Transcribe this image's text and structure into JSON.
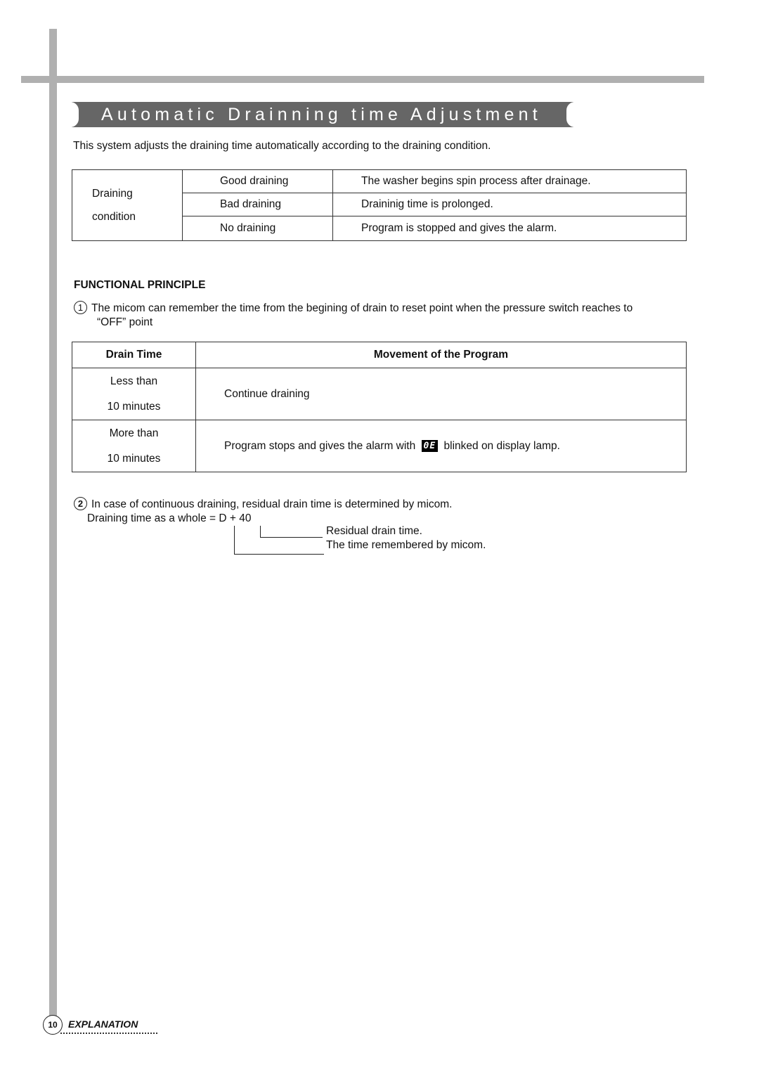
{
  "title": "Automatic Drainning time Adjustment",
  "intro": "This system adjusts the draining time automatically according to the draining condition.",
  "condition_table": {
    "row_header_line1": "Draining",
    "row_header_line2": "condition",
    "rows": [
      {
        "state": "Good draining",
        "result": "The washer begins spin process after drainage."
      },
      {
        "state": "Bad draining",
        "result": "Draininig time is prolonged."
      },
      {
        "state": "No draining",
        "result": "Program is stopped and gives the alarm."
      }
    ]
  },
  "section_heading": "FUNCTIONAL PRINCIPLE",
  "point1": {
    "number": "1",
    "line1": "The micom can remember the time from the begining of drain to reset point when the pressure switch reaches to",
    "line2": "“OFF” point"
  },
  "drain_table": {
    "headers": [
      "Drain Time",
      "Movement of the Program"
    ],
    "rows": [
      {
        "time_line1": "Less than",
        "time_line2": "10 minutes",
        "movement": "Continue draining"
      },
      {
        "time_line1": "More than",
        "time_line2": "10 minutes",
        "movement_before": "Program stops and gives the alarm with",
        "display_code": "0E",
        "movement_after": "blinked on display lamp."
      }
    ]
  },
  "point2": {
    "number": "2",
    "line1": "In case of continuous draining, residual drain time is determined by micom.",
    "line2": "Draining time as a whole = D + 40",
    "label_residual": "Residual drain time.",
    "label_remembered": "The time remembered by micom."
  },
  "footer": {
    "page_number": "10",
    "section": "EXPLANATION"
  }
}
